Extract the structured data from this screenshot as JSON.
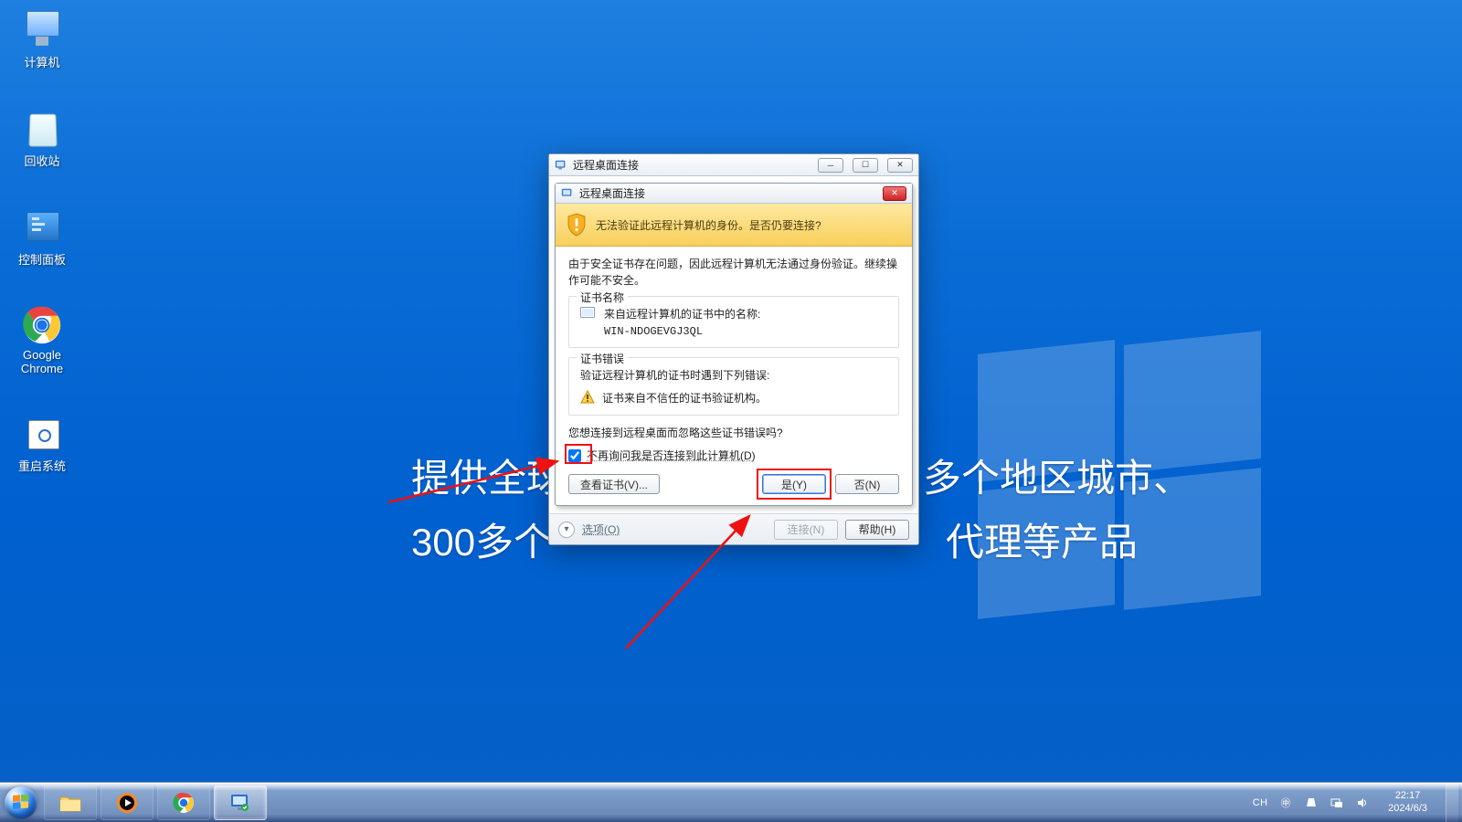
{
  "desktop": {
    "icons": {
      "computer": "计算机",
      "recycle": "回收站",
      "cpanel": "控制面板",
      "chrome": "Google Chrome",
      "restart": "重启系统"
    },
    "bg_text_1": "提供全球",
    "bg_text_2": "多个地区城市、",
    "bg_text_3": "300多个",
    "bg_text_4": "代理等产品"
  },
  "rdc": {
    "title": "远程桌面连接",
    "options_label": "选项(O)",
    "btn_connect": "连接(N)",
    "btn_help": "帮助(H)"
  },
  "cert_dialog": {
    "title": "远程桌面连接",
    "warning": "无法验证此远程计算机的身份。是否仍要连接?",
    "explain": "由于安全证书存在问题，因此远程计算机无法通过身份验证。继续操作可能不安全。",
    "cert_name_legend": "证书名称",
    "cert_name_desc": "来自远程计算机的证书中的名称:",
    "cert_name_value": "WIN-NDOGEVGJ3QL",
    "cert_err_legend": "证书错误",
    "cert_err_desc": "验证远程计算机的证书时遇到下列错误:",
    "cert_err_item": "证书来自不信任的证书验证机构。",
    "prompt": "您想连接到远程桌面而忽略这些证书错误吗?",
    "dont_ask": "不再询问我是否连接到此计算机(D)",
    "btn_view_cert": "查看证书(V)...",
    "btn_yes": "是(Y)",
    "btn_no": "否(N)"
  },
  "taskbar": {
    "lang": "CH",
    "time": "22:17",
    "date": "2024/6/3"
  }
}
